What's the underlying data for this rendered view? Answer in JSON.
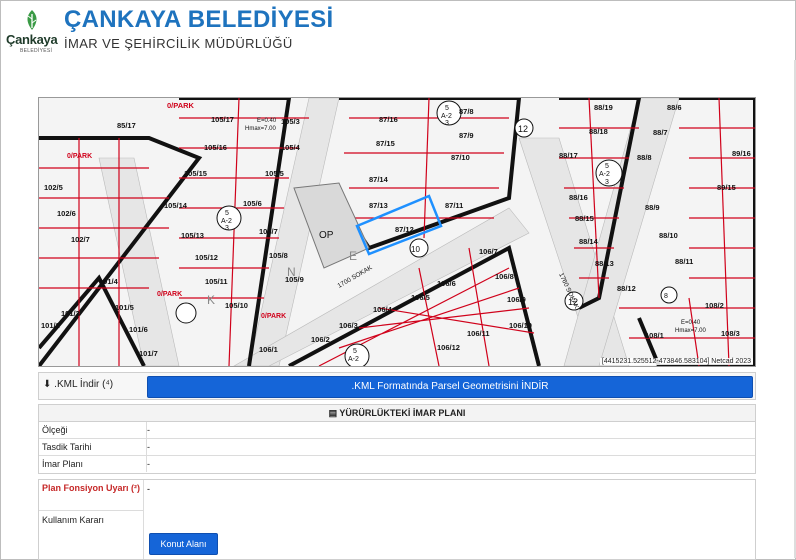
{
  "header": {
    "logo_word": "Çankaya",
    "logo_sub": "BELEDİYESİ",
    "title": "ÇANKAYA BELEDİYESİ",
    "subtitle": "İMAR VE ŞEHİRCİLİK MÜDÜRLÜĞÜ",
    "logo_color": "#3a9a45",
    "title_color": "#1e73be"
  },
  "map": {
    "footer": "[4415231.525512-473846.583104] Netcad 2023",
    "selected_parcel": "87/12",
    "selection_color": "#1e90ff",
    "parcel_line_color": "#d0021b",
    "labels": {
      "p1": "85/17",
      "p2": "0/PARK",
      "p3": "105/17",
      "p4": "105/3",
      "p5": "87/16",
      "p6": "87/8",
      "p7": "88/19",
      "p8": "88/6",
      "p9": "88/18",
      "p10": "88/7",
      "p11": "105/16",
      "p12": "105/4",
      "p13": "87/15",
      "p14": "87/9",
      "p15": "87/10",
      "p16": "88/17",
      "p17": "88/8",
      "p18": "89/16",
      "p19": "89/15",
      "p20": "102/5",
      "p21": "102/6",
      "p22": "102/7",
      "p23": "105/15",
      "p24": "105/5",
      "p25": "105/14",
      "p26": "105/6",
      "p27": "87/14",
      "p28": "87/13",
      "p29": "87/11",
      "p30": "87/12",
      "p31": "88/16",
      "p32": "88/15",
      "p33": "88/14",
      "p34": "88/13",
      "p35": "88/9",
      "p36": "88/10",
      "p37": "88/11",
      "p38": "88/12",
      "p39": "105/13",
      "p40": "105/7",
      "p41": "105/12",
      "p42": "105/8",
      "p43": "105/11",
      "p44": "105/9",
      "p45": "105/10",
      "p46": "101/4",
      "p47": "101/5",
      "p48": "101/3",
      "p49": "101/6",
      "p50": "101/2",
      "p51": "101/7",
      "p52": "106/7",
      "p53": "106/8",
      "p54": "106/6",
      "p55": "106/9",
      "p56": "106/5",
      "p57": "106/10",
      "p58": "106/4",
      "p59": "106/11",
      "p60": "106/3",
      "p61": "106/2",
      "p62": "106/12",
      "p63": "106/1",
      "p64": "108/2",
      "p65": "108/1",
      "p66": "108/3",
      "op": "OP",
      "e": "E",
      "n": "N",
      "k": "K",
      "z1": "5",
      "z2": "A-2",
      "z3": "3",
      "road1": "1700 SOKAK",
      "road2": "1760 SOKAK",
      "num1": "12",
      "num2": "10",
      "num3": "8",
      "num4": "12",
      "note1": "E=0.40",
      "note2": "Hmax=7.00",
      "note3": "E=0.40",
      "note4": "Hmax=7.00",
      "park2": "0/PARK",
      "park3": "0/PARK",
      "park4": "0/PARK"
    }
  },
  "kml": {
    "label": ".KML İndir (⁴)",
    "button": ".KML Formatında Parsel Geometrisini İNDİR",
    "icon": "download-icon"
  },
  "plan": {
    "title": "YÜRÜRLÜKTEKİ İMAR PLANI",
    "icon": "table-icon",
    "rows": [
      {
        "label": "Ölçeği",
        "value": "-"
      },
      {
        "label": "Tasdik Tarihi",
        "value": "-"
      },
      {
        "label": "İmar Planı",
        "value": "-"
      }
    ]
  },
  "fonksiyon": {
    "warning": "Plan Fonsiyon Uyarı (²)",
    "warning_value": "-",
    "kk_label": "Kullanım Kararı",
    "button": "Konut Alanı"
  },
  "colors": {
    "accent": "#1565d8",
    "warning": "#c62828"
  }
}
